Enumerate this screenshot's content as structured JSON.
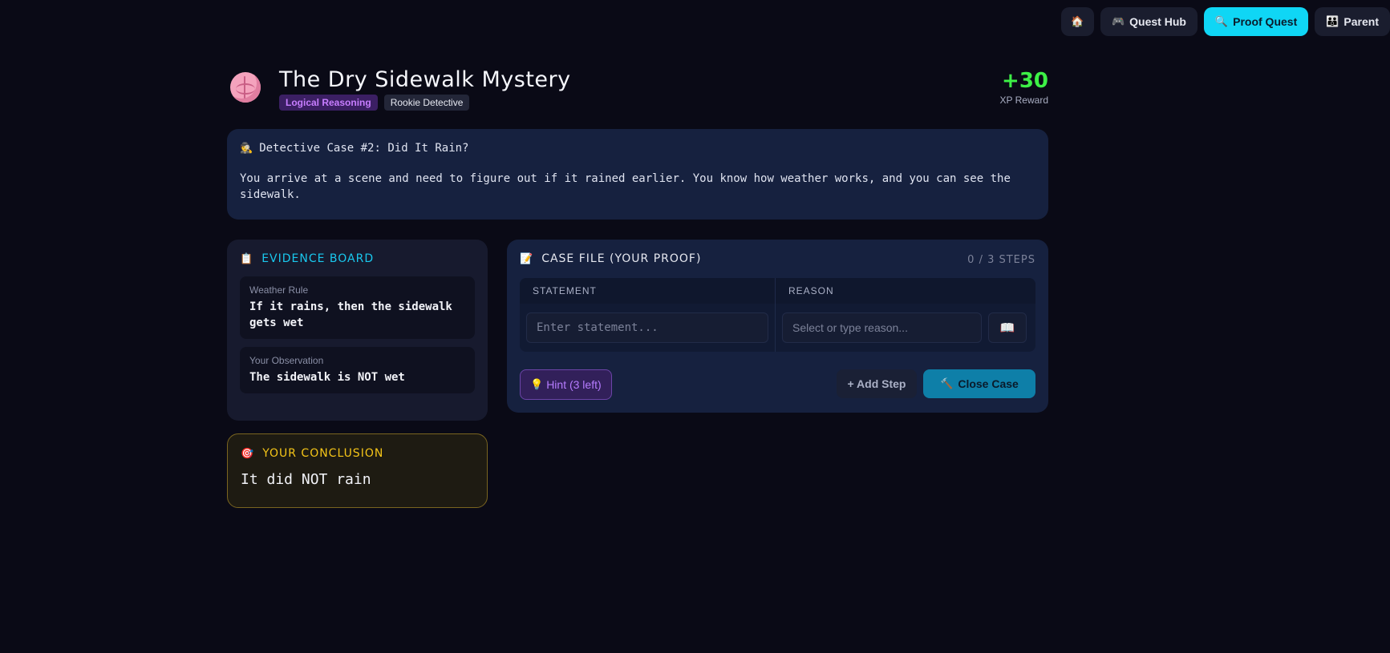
{
  "nav": {
    "home_icon": "home-icon",
    "quest_hub": "Quest Hub",
    "proof_quest": "Proof Quest",
    "parent": "Parent"
  },
  "header": {
    "title": "The Dry Sidewalk Mystery",
    "tag_category": "Logical Reasoning",
    "tag_level": "Rookie Detective",
    "xp_value": "+30",
    "xp_label": "XP Reward"
  },
  "case": {
    "title": "Detective Case #2: Did It Rain?",
    "description": "You arrive at a scene and need to figure out if it rained earlier. You know how weather works, and you can see the sidewalk."
  },
  "evidence": {
    "heading": "EVIDENCE BOARD",
    "items": [
      {
        "label": "Weather Rule",
        "text": "If it rains, then the sidewalk gets wet"
      },
      {
        "label": "Your Observation",
        "text": "The sidewalk is NOT wet"
      }
    ]
  },
  "conclusion": {
    "heading": "YOUR CONCLUSION",
    "text": "It did NOT rain"
  },
  "casefile": {
    "heading": "CASE FILE (YOUR PROOF)",
    "steps": "0 / 3 STEPS",
    "col_statement": "STATEMENT",
    "col_reason": "REASON",
    "statement_placeholder": "Enter statement...",
    "reason_placeholder": "Select or type reason...",
    "hint_label": "Hint (3 left)",
    "add_step_label": "+ Add Step",
    "close_case_label": "Close Case"
  },
  "colors": {
    "accent": "#0fd6f5",
    "xp": "#3df046",
    "conclusion": "#f5c518",
    "hint": "#b67cff"
  }
}
